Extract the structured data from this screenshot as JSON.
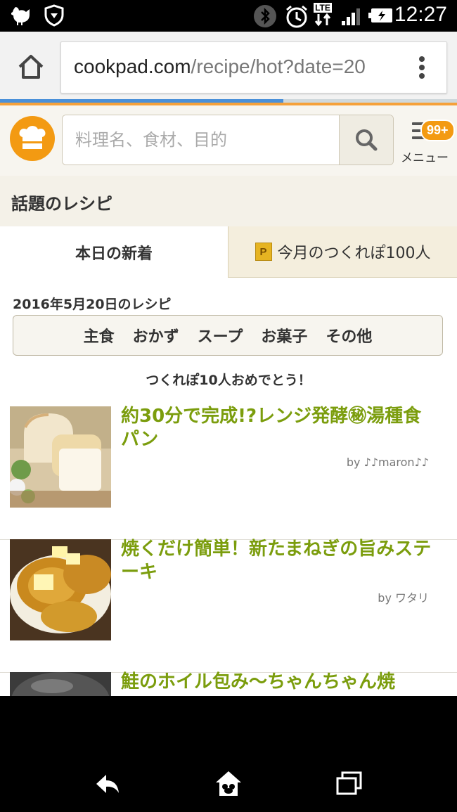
{
  "status_bar": {
    "time": "12:27",
    "network": "LTE"
  },
  "browser": {
    "url_host": "cookpad.com",
    "url_path": "/recipe/hot?date=20",
    "progress": 0.62
  },
  "header": {
    "search_placeholder": "料理名、食材、目的",
    "menu_label": "メニュー",
    "badge": "99+"
  },
  "section": {
    "title": "話題のレシピ"
  },
  "tabs": [
    {
      "label": "本日の新着"
    },
    {
      "label": "今月のつくれぽ100人",
      "icon_text": "P"
    }
  ],
  "date_label": "2016年5月20日のレシピ",
  "categories": [
    "主食",
    "おかず",
    "スープ",
    "お菓子",
    "その他"
  ],
  "congrats": "つくれぽ10人おめでとう！",
  "recipes": [
    {
      "title": "約30分で完成!?レンジ発酵㊙湯種食パン",
      "author": "by ♪♪maron♪♪"
    },
    {
      "title": "焼くだけ簡単！新たまねぎの旨みステーキ",
      "author": "by ワタリ"
    },
    {
      "title": "鮭のホイル包み〜ちゃんちゃん焼",
      "author": ""
    }
  ],
  "colors": {
    "brand_orange": "#f39a12",
    "recipe_title_green": "#7b9d0d",
    "page_bg": "#f7f5ef"
  }
}
